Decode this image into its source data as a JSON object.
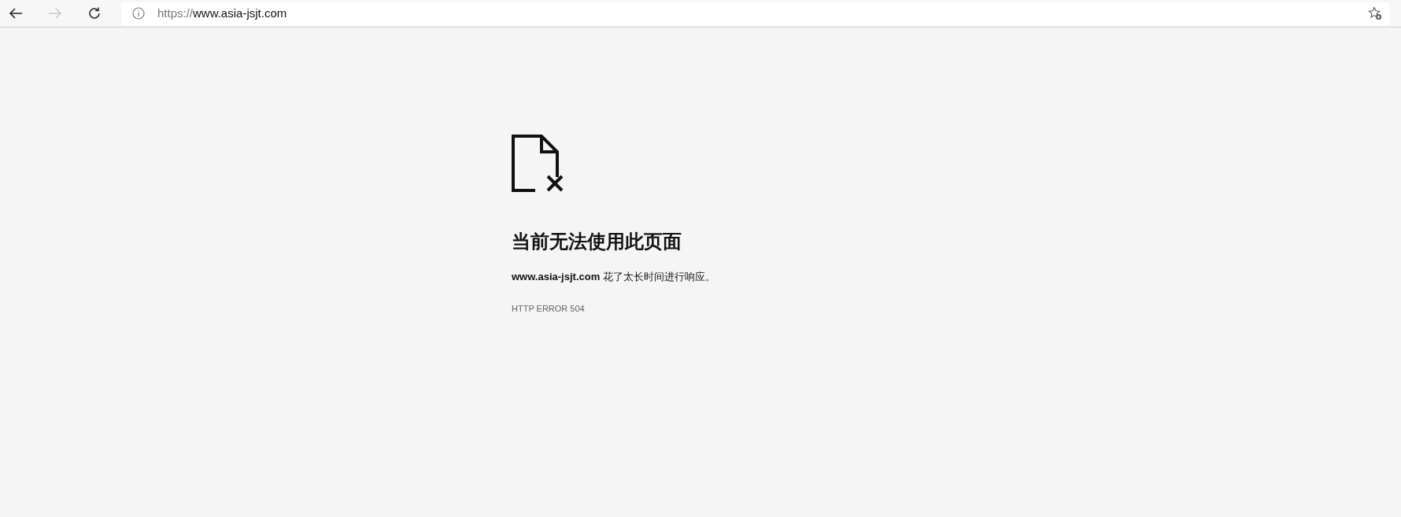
{
  "toolbar": {
    "back": {
      "disabled": false
    },
    "forward": {
      "disabled": true
    },
    "address": {
      "scheme": "https://",
      "host": "www.asia-jsjt.com"
    }
  },
  "error": {
    "title": "当前无法使用此页面",
    "message": "**www.asia-jsjt.com** 花了太长时间进行响应。",
    "code": "HTTP ERROR 504"
  }
}
